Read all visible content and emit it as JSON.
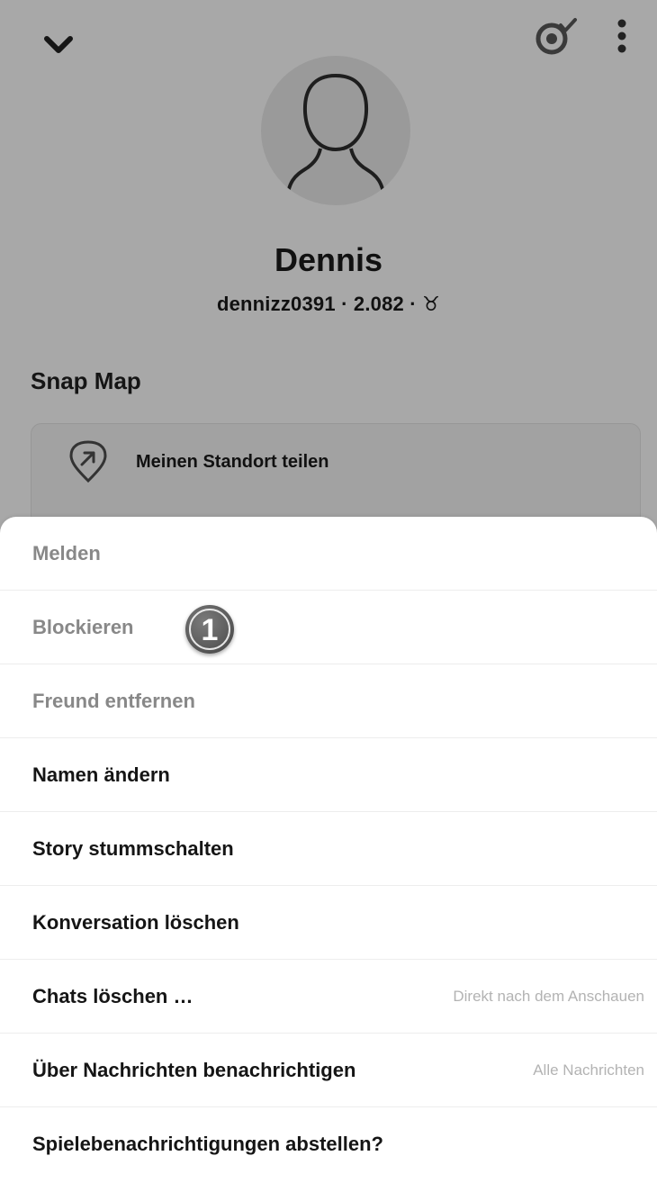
{
  "profile": {
    "name": "Dennis",
    "meta": "dennizz0391 · 2.082 · ♉",
    "snap_map_title": "Snap Map",
    "share_location_label": "Meinen Standort teilen"
  },
  "top_icons": [
    "chevron-down-icon",
    "friend-check-icon",
    "more-vertical-icon"
  ],
  "menu": {
    "items": [
      {
        "label": "Melden",
        "style": "muted"
      },
      {
        "label": "Blockieren",
        "style": "muted"
      },
      {
        "label": "Freund entfernen",
        "style": "muted"
      },
      {
        "label": "Namen ändern",
        "style": "strong"
      },
      {
        "label": "Story stummschalten",
        "style": "strong"
      },
      {
        "label": "Konversation löschen",
        "style": "strong"
      },
      {
        "label": "Chats löschen …",
        "style": "strong",
        "value": "Direkt nach dem Anschauen"
      },
      {
        "label": "Über Nachrichten benachrichtigen",
        "style": "strong",
        "value": "Alle Nachrichten"
      },
      {
        "label": "Spielebenachrichtigungen abstellen?",
        "style": "strong"
      }
    ]
  },
  "annotation": {
    "step_number": "1"
  },
  "colors": {
    "overlay": "#a8a8a8",
    "sheet": "#ffffff",
    "muted_text": "#888888",
    "value_text": "#b3b3b3"
  }
}
